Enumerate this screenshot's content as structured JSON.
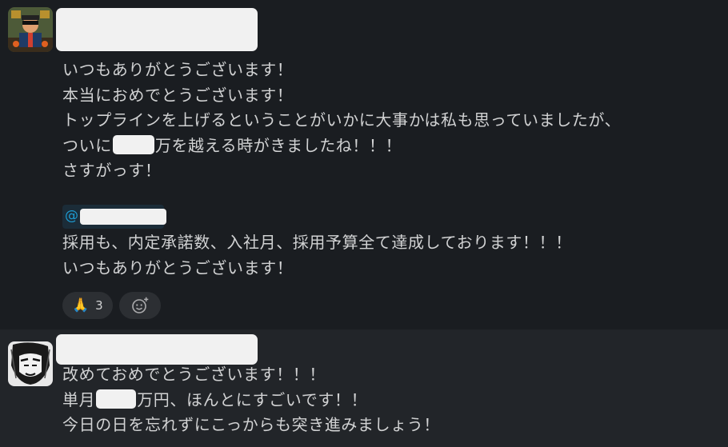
{
  "message1": {
    "lines": [
      "いつもありがとうございます！",
      "本当におめでとうございます！",
      "トップラインを上げるということがいかに大事かは私も思っていましたが、",
      {
        "before": "ついに",
        "after": "万を越える時がきましたね！！！"
      },
      "さすがっす！"
    ],
    "mention_at": "@",
    "quote_lines": [
      "採用も、内定承諾数、入社月、採用予算全て達成しております！！！",
      "いつもありがとうございます！"
    ],
    "reaction": {
      "emoji": "🙏",
      "count": "3"
    }
  },
  "message2": {
    "lines": [
      "改めておめでとうございます！！！",
      {
        "before": "単月",
        "after": "万円、ほんとにすごいです！！"
      },
      "今日の日を忘れずにこっからも突き進みましょう！"
    ]
  },
  "colors": {
    "background": "#1a1d21",
    "hover_background": "#222529",
    "text": "#d1d2d3",
    "mention": "#1d9bd1",
    "redaction": "#f1f1f1"
  },
  "icons": {
    "add_reaction": "emoji-add-icon",
    "reaction_emoji": "clap-icon"
  }
}
